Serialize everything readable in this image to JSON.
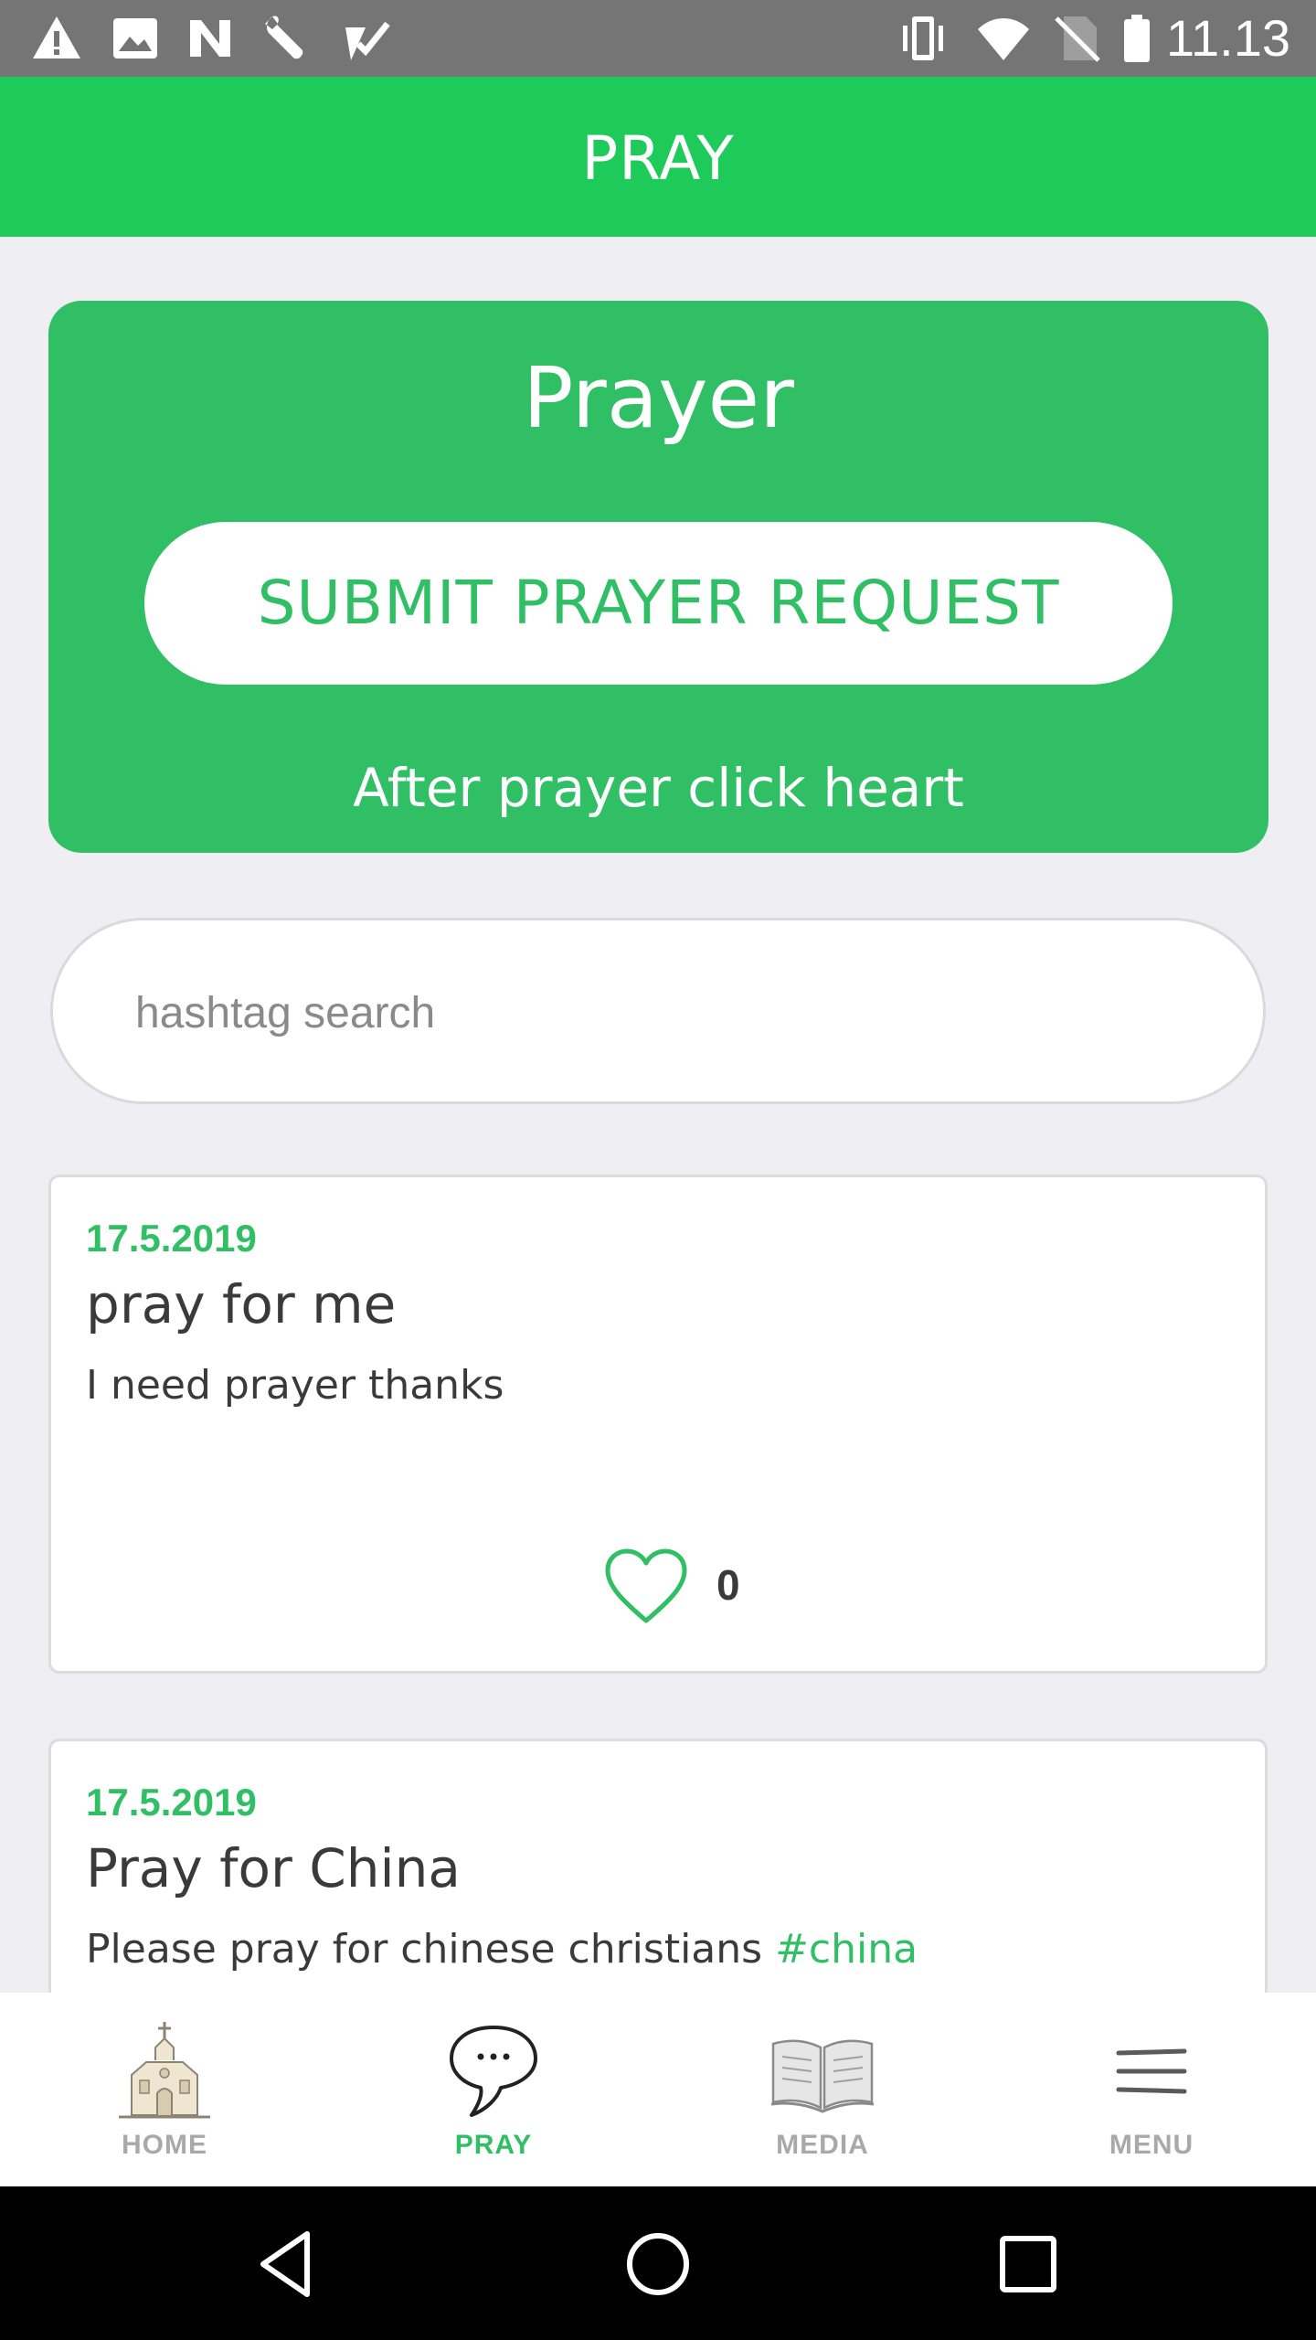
{
  "status_bar": {
    "time": "11.13",
    "left_icons": [
      "warning-icon",
      "image-icon",
      "n-icon",
      "wrench-icon",
      "check-icon"
    ],
    "right_icons": [
      "vibrate-icon",
      "wifi-icon",
      "no-sim-icon",
      "battery-icon"
    ]
  },
  "app_bar": {
    "title": "PRAY"
  },
  "prayer_card": {
    "heading": "Prayer",
    "submit_label": "SUBMIT PRAYER REQUEST",
    "hint": "After prayer click heart"
  },
  "search": {
    "placeholder": "hashtag search",
    "value": ""
  },
  "posts": [
    {
      "date": "17.5.2019",
      "title": "pray for me",
      "body": "I need prayer thanks",
      "hashtag": "",
      "likes": "0"
    },
    {
      "date": "17.5.2019",
      "title": "Pray for China",
      "body": "Please pray for chinese christians ",
      "hashtag": "#china",
      "likes": ""
    }
  ],
  "bottom_nav": {
    "items": [
      {
        "label": "HOME",
        "icon": "church-icon"
      },
      {
        "label": "PRAY",
        "icon": "speech-bubble-icon",
        "active": true
      },
      {
        "label": "MEDIA",
        "icon": "open-book-icon"
      },
      {
        "label": "MENU",
        "icon": "menu-icon"
      }
    ]
  },
  "colors": {
    "app_bar": "#1ecb5a",
    "accent": "#30bf64",
    "background": "#efeff3",
    "status_bar": "#757575"
  }
}
